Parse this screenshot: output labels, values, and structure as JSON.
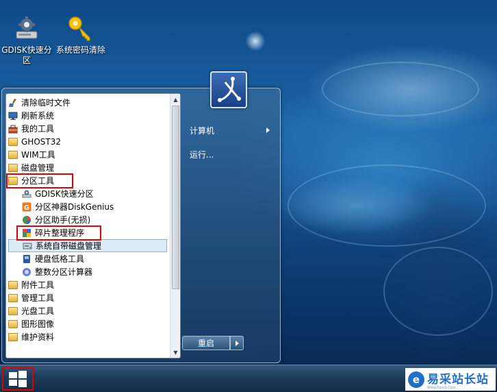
{
  "desktop": {
    "icons": [
      {
        "label": "GDISK快速分区",
        "icon": "gdisk-icon"
      },
      {
        "label": "系统密码清除",
        "icon": "key-icon"
      }
    ]
  },
  "start_menu": {
    "programs": [
      {
        "label": "清除临时文件",
        "icon": "broom-icon"
      },
      {
        "label": "刷新系统",
        "icon": "monitor-icon"
      },
      {
        "label": "我的工具",
        "icon": "toolbox-icon"
      },
      {
        "label": "GHOST32",
        "icon": "folder-icon"
      },
      {
        "label": "WIM工具",
        "icon": "folder-icon"
      },
      {
        "label": "磁盘管理",
        "icon": "folder-icon"
      },
      {
        "label": "分区工具",
        "icon": "folder-icon",
        "highlighted": true
      },
      {
        "label": "GDISK快速分区",
        "icon": "gdisk-icon"
      },
      {
        "label": "分区神器DiskGenius",
        "icon": "diskgenius-icon"
      },
      {
        "label": "分区助手(无损)",
        "icon": "partition-assistant-icon"
      },
      {
        "label": "碎片整理程序",
        "icon": "defrag-icon",
        "highlighted": true
      },
      {
        "label": "系统自带磁盘管理",
        "icon": "disk-management-icon",
        "selected": true
      },
      {
        "label": "硬盘低格工具",
        "icon": "lowformat-icon"
      },
      {
        "label": "整数分区计算器",
        "icon": "calculator-icon"
      },
      {
        "label": "附件工具",
        "icon": "folder-icon"
      },
      {
        "label": "管理工具",
        "icon": "folder-icon"
      },
      {
        "label": "光盘工具",
        "icon": "folder-icon"
      },
      {
        "label": "图形图像",
        "icon": "folder-icon"
      },
      {
        "label": "维护资料",
        "icon": "folder-icon"
      }
    ],
    "right_items": [
      {
        "label": "计算机",
        "has_submenu": true
      },
      {
        "label": "运行..."
      }
    ],
    "restart_label": "重启"
  },
  "taskbar": {
    "watermark_text": "易采站长站",
    "watermark_glyph": "e",
    "watermark_sub": "Www.Easck.Com"
  },
  "colors": {
    "highlight_border": "#e00000",
    "selection_bg": "#dcebf8",
    "watermark_blue": "#1f6fc5"
  }
}
